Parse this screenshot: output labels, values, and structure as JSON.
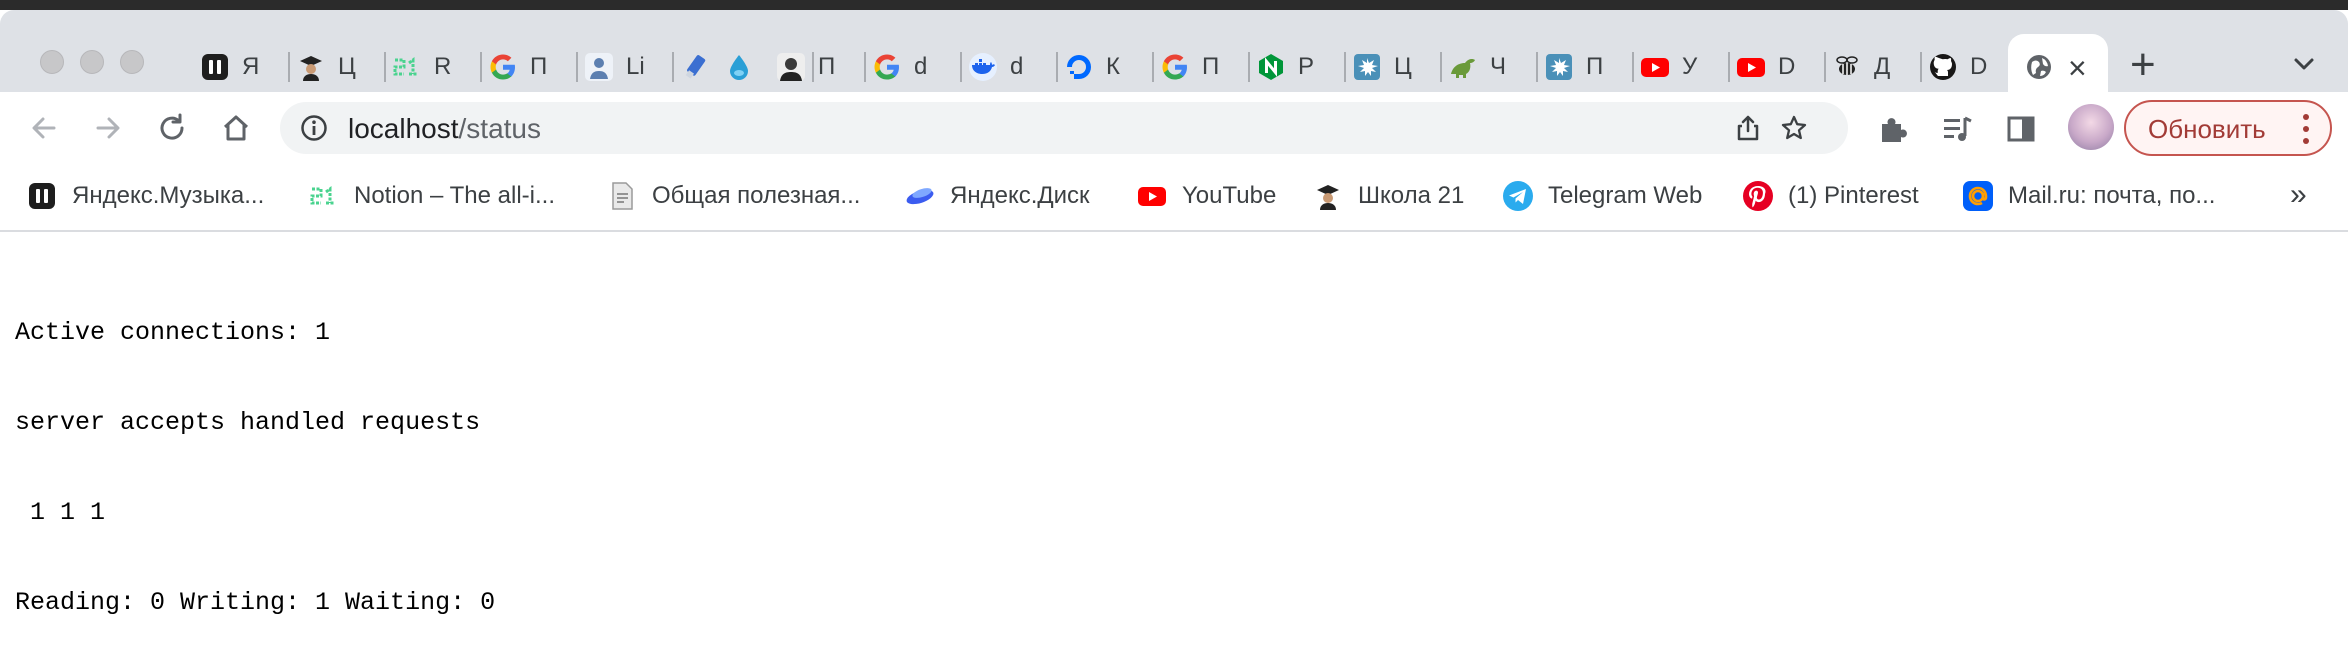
{
  "tabs": [
    {
      "title": "Я",
      "icon": "yandex-music-icon",
      "color": "#222222"
    },
    {
      "title": "Ц",
      "icon": "school21-graduate-icon",
      "color": "#333333"
    },
    {
      "title": "R",
      "icon": "school21-logo-icon",
      "color": "#4ad38f"
    },
    {
      "title": "П",
      "icon": "google-icon",
      "color": "#4285f4"
    },
    {
      "title": "Li",
      "icon": "profile-photo-icon",
      "color": "#5c7fb0"
    },
    {
      "title": "",
      "icon": "usb-drive-icon",
      "color": "#3b6fd1"
    },
    {
      "title": "",
      "icon": "water-drop-icon",
      "color": "#2a9fd6"
    },
    {
      "title": "П",
      "icon": "person-portrait-icon",
      "color": "#444444"
    },
    {
      "title": "d",
      "icon": "google-icon",
      "color": "#4285f4"
    },
    {
      "title": "d",
      "icon": "docker-icon",
      "color": "#1d63ed"
    },
    {
      "title": "К",
      "icon": "digitalocean-icon",
      "color": "#0069ff"
    },
    {
      "title": "П",
      "icon": "google-icon",
      "color": "#4285f4"
    },
    {
      "title": "Р",
      "icon": "nginx-icon",
      "color": "#009639"
    },
    {
      "title": "Ц",
      "icon": "splash-icon",
      "color": "#4a90b8"
    },
    {
      "title": "Ч",
      "icon": "dinosaur-icon",
      "color": "#6a9a3a"
    },
    {
      "title": "П",
      "icon": "splash-icon",
      "color": "#4a90b8"
    },
    {
      "title": "У",
      "icon": "youtube-icon",
      "color": "#ff0000"
    },
    {
      "title": "D",
      "icon": "youtube-icon",
      "color": "#ff0000"
    },
    {
      "title": "Д",
      "icon": "bee-icon",
      "color": "#222222"
    },
    {
      "title": "D",
      "icon": "github-icon",
      "color": "#181717"
    }
  ],
  "active_tab": {
    "icon": "globe-icon",
    "close_label": "×"
  },
  "new_tab_label": "+",
  "address_bar": {
    "host": "localhost",
    "path": "/status"
  },
  "update_button": {
    "label": "Обновить"
  },
  "bookmarks": [
    {
      "label": "Яндекс.Музыка...",
      "icon": "yandex-music-icon",
      "color": "#222222"
    },
    {
      "label": "Notion – The all-i...",
      "icon": "school21-logo-icon",
      "color": "#4ad38f"
    },
    {
      "label": "Общая полезная...",
      "icon": "document-icon",
      "color": "#8a8a8a"
    },
    {
      "label": "Яндекс.Диск",
      "icon": "yandex-disk-icon",
      "color": "#3b5cf0"
    },
    {
      "label": "YouTube",
      "icon": "youtube-icon",
      "color": "#ff0000"
    },
    {
      "label": "Школа 21",
      "icon": "school21-graduate-icon",
      "color": "#333333"
    },
    {
      "label": "Telegram Web",
      "icon": "telegram-icon",
      "color": "#2aabee"
    },
    {
      "label": "(1) Pinterest",
      "icon": "pinterest-icon",
      "color": "#e60023"
    },
    {
      "label": "Mail.ru: почта, по...",
      "icon": "mailru-icon",
      "color": "#005ff9"
    }
  ],
  "bookmarks_more": "»",
  "status_lines": [
    "Active connections: 1",
    "server accepts handled requests",
    " 1 1 1",
    "Reading: 0 Writing: 1 Waiting: 0"
  ]
}
